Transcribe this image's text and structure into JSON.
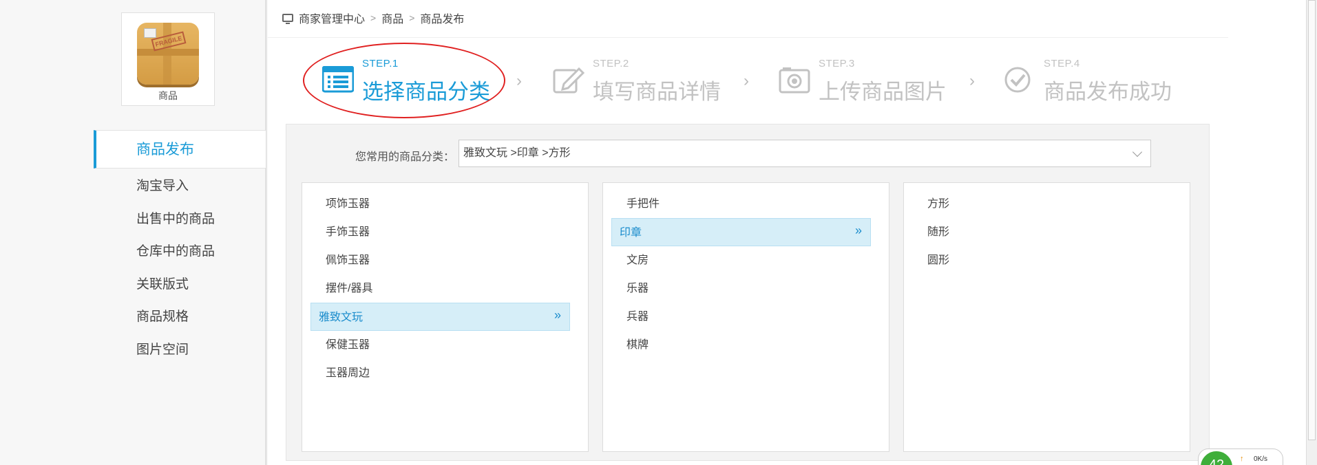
{
  "sidebar": {
    "logo_caption": "商品",
    "logo_stamp": "FRAGILE",
    "menu": [
      {
        "label": "商品发布",
        "active": true
      },
      {
        "label": "淘宝导入"
      },
      {
        "label": "出售中的商品"
      },
      {
        "label": "仓库中的商品"
      },
      {
        "label": "关联版式"
      },
      {
        "label": "商品规格"
      },
      {
        "label": "图片空间"
      }
    ]
  },
  "breadcrumb": {
    "items": [
      "商家管理中心",
      "商品",
      "商品发布"
    ],
    "separator": ">"
  },
  "steps": [
    {
      "num": "STEP.1",
      "title": "选择商品分类",
      "state": "current",
      "icon": "list-icon"
    },
    {
      "num": "STEP.2",
      "title": "填写商品详情",
      "state": "todo",
      "icon": "edit-icon"
    },
    {
      "num": "STEP.3",
      "title": "上传商品图片",
      "state": "todo",
      "icon": "camera-icon"
    },
    {
      "num": "STEP.4",
      "title": "商品发布成功",
      "state": "todo",
      "icon": "check-circle-icon"
    }
  ],
  "step_arrow": "›",
  "favorites": {
    "label": "您常用的商品分类：",
    "selected": "雅致文玩 >印章 >方形"
  },
  "category_columns": [
    {
      "items": [
        "项饰玉器",
        "手饰玉器",
        "佩饰玉器",
        "摆件/器具",
        "雅致文玩",
        "保健玉器",
        "玉器周边"
      ],
      "selected": 4
    },
    {
      "items": [
        "手把件",
        "印章",
        "文房",
        "乐器",
        "兵器",
        "棋牌"
      ],
      "selected": 1
    },
    {
      "items": [
        "方形",
        "随形",
        "圆形"
      ],
      "selected": -1
    }
  ],
  "expand_glyph": "»",
  "net_badge": {
    "count": "42",
    "speed": "0K/s",
    "up_glyph": "↑"
  },
  "colors": {
    "accent": "#1a9bd7",
    "highlight_bg": "#d6eef8",
    "annotation": "#e02020"
  }
}
